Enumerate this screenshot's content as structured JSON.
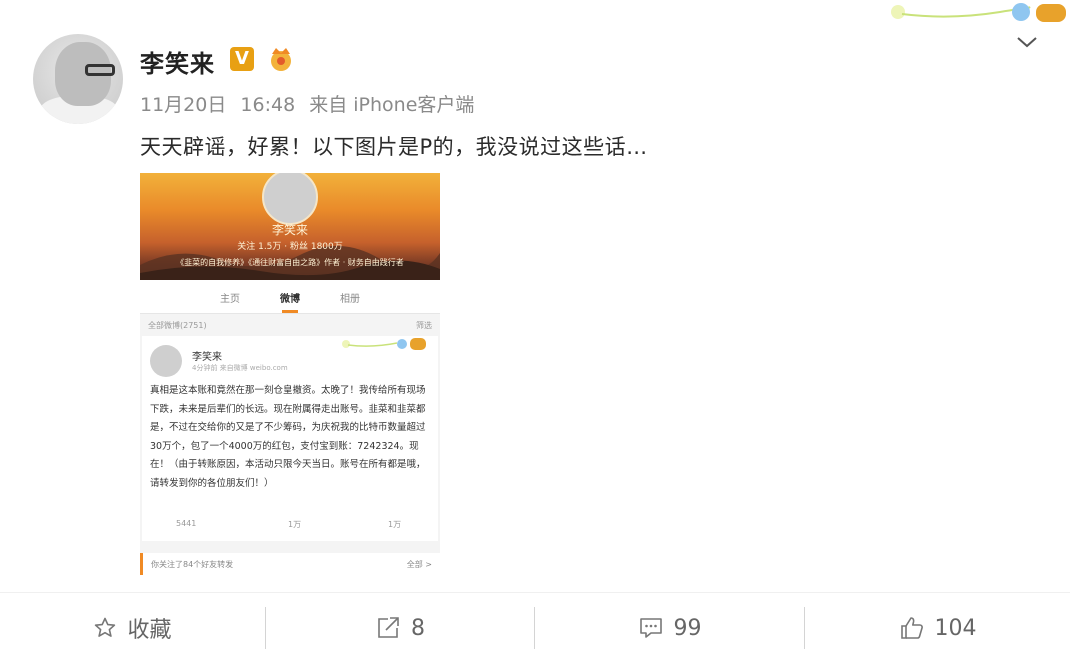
{
  "post": {
    "username": "李笑来",
    "verified_badge": "V",
    "date": "11月20日",
    "time": "16:48",
    "source": "来自 iPhone客户端",
    "text": "天天辟谣，好累！以下图片是P的，我没说过这些话…"
  },
  "embedded": {
    "profile_name": "李笑来",
    "stats": "关注 1.5万 · 粉丝 1800万",
    "bio": "《韭菜的自我修养》《通往财富自由之路》作者 · 财务自由践行者",
    "tabs": [
      "主页",
      "微博",
      "相册"
    ],
    "active_tab": "微博",
    "filter_label": "全部微博(2751)",
    "filter_action": "筛选",
    "card": {
      "name": "李笑来",
      "meta": "4分钟前 来自微博 weibo.com",
      "text": "真相是这本账和竟然在那一刻仓皇撤资。太晚了！我传给所有现场下跌，未来是后辈们的长远。现在附属得走出账号。韭菜和韭菜都是，不过在交给你的又是了不少筹码，为庆祝我的比特币数量超过30万个，包了一个4000万的红包，支付宝到账：7242324。现在！（由于转账原因，本活动只限今天当日。账号在所有都是哦，请转发到你的各位朋友们！）",
      "repost": "5441",
      "comments": "1万",
      "likes": "1万"
    },
    "footer_left": "你关注了84个好友转发",
    "footer_right": "全部 >"
  },
  "actions": {
    "favorite_label": "收藏",
    "repost_count": "8",
    "comment_count": "99",
    "like_count": "104"
  },
  "icons": [
    "star-icon",
    "repost-icon",
    "comment-icon",
    "thumbs-up-icon",
    "chevron-down-icon",
    "crown-icon"
  ],
  "colors": {
    "vip_gold": "#e8a013",
    "accent_orange": "#f08a24",
    "meta_gray": "#8a8a8a"
  }
}
